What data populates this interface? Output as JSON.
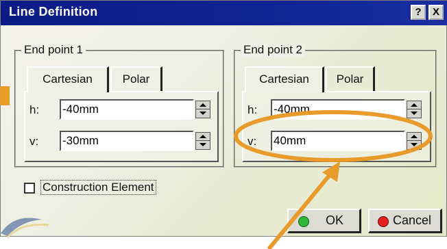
{
  "window": {
    "title": "Line Definition",
    "help_icon_label": "?",
    "close_icon_label": "X"
  },
  "end_point_1": {
    "legend": "End point 1",
    "tabs": [
      {
        "label": "Cartesian",
        "active": true
      },
      {
        "label": "Polar",
        "active": false
      }
    ],
    "h_label": "h:",
    "h_value": "-40mm",
    "v_label": "v:",
    "v_value": "-30mm"
  },
  "end_point_2": {
    "legend": "End point 2",
    "tabs": [
      {
        "label": "Cartesian",
        "active": true
      },
      {
        "label": "Polar",
        "active": false
      }
    ],
    "h_label": "h:",
    "h_value": "-40mm",
    "v_label": "v:",
    "v_value": "40mm"
  },
  "construction_element": {
    "label": "Construction Element",
    "checked": false
  },
  "buttons": {
    "ok_label": "OK",
    "cancel_label": "Cancel"
  },
  "colors": {
    "titlebar": "#0f2392",
    "annotation_orange": "#e89a2a",
    "ok_dot": "#2db83a",
    "cancel_dot": "#e02020"
  }
}
